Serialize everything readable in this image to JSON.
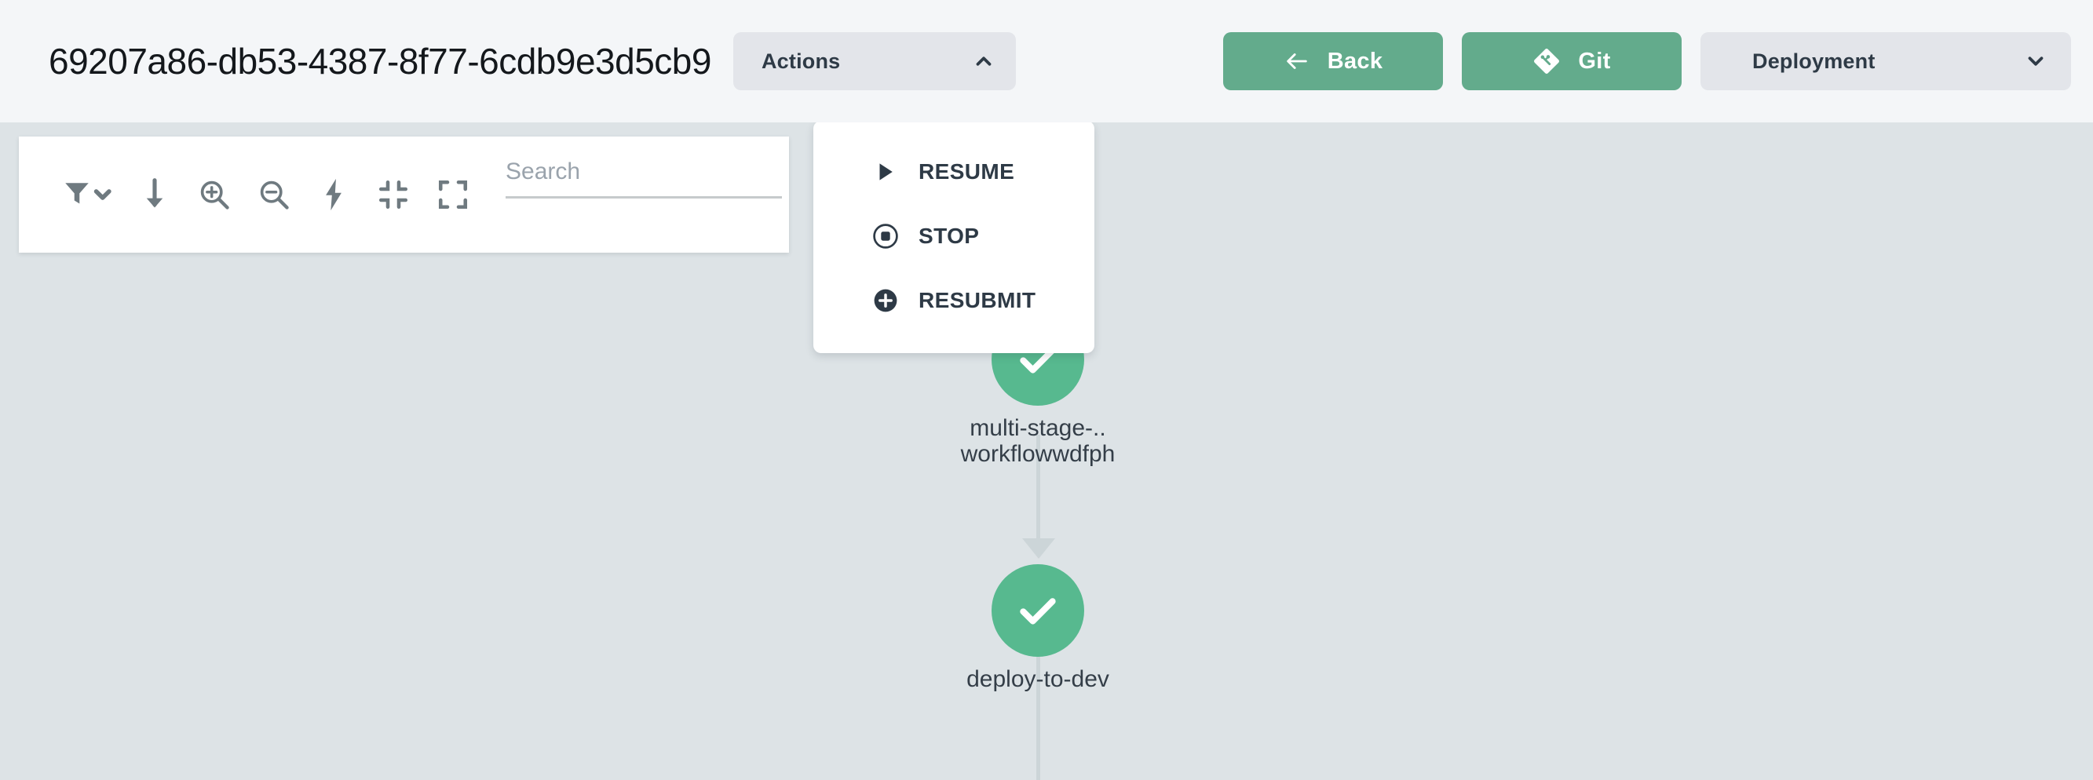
{
  "header": {
    "workflow_id": "69207a86-db53-4387-8f77-6cdb9e3d5cb9",
    "actions_button": {
      "label": "Actions",
      "icon": "chevron-up-icon"
    },
    "back_button": {
      "label": "Back",
      "icon": "arrow-left-icon"
    },
    "git_button": {
      "label": "Git",
      "icon": "git-icon"
    },
    "deployment_button": {
      "label": "Deployment",
      "icon": "chevron-down-icon"
    }
  },
  "actions_menu": {
    "open": true,
    "items": [
      {
        "label": "RESUME",
        "icon": "play-icon"
      },
      {
        "label": "STOP",
        "icon": "stop-circle-icon"
      },
      {
        "label": "RESUBMIT",
        "icon": "plus-circle-icon"
      }
    ]
  },
  "toolbar": {
    "buttons": [
      {
        "name": "filter-icon",
        "title": "Filter"
      },
      {
        "name": "arrow-down-icon",
        "title": "Collapse/expand order"
      },
      {
        "name": "zoom-in-icon",
        "title": "Zoom in"
      },
      {
        "name": "zoom-out-icon",
        "title": "Zoom out"
      },
      {
        "name": "lightning-bolt-icon",
        "title": "Quick actions"
      },
      {
        "name": "collapse-icon",
        "title": "Reset zoom"
      },
      {
        "name": "fullscreen-icon",
        "title": "Fullscreen"
      }
    ],
    "search": {
      "placeholder": "Search",
      "value": ""
    }
  },
  "graph": {
    "nodes": [
      {
        "id": "multi-stage-workflowwdfph",
        "status": "succeeded",
        "status_icon": "check-icon",
        "label_lines": [
          "multi-stage-..",
          "workflowwdfph"
        ]
      },
      {
        "id": "deploy-to-dev",
        "status": "succeeded",
        "status_icon": "check-icon",
        "label_lines": [
          "deploy-to-dev"
        ]
      }
    ]
  },
  "colors": {
    "accent_green": "#63ab8c",
    "node_green": "#57b98f",
    "canvas_bg": "#dde3e6",
    "header_bg": "#f4f6f8",
    "text_dark": "#2e3a46",
    "icon_grey": "#6f7a80",
    "edge_grey": "#ccd5d8"
  }
}
